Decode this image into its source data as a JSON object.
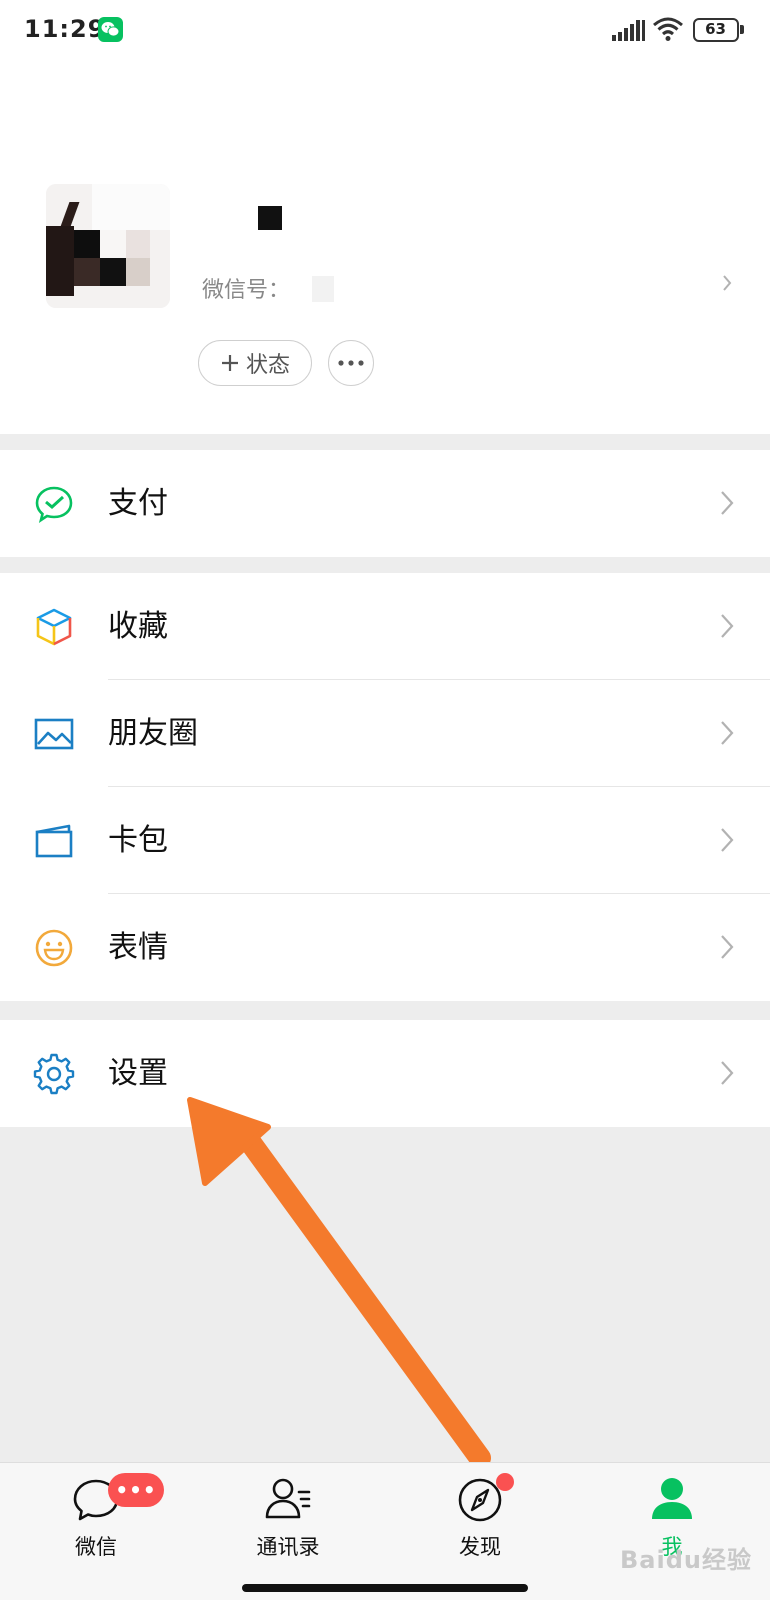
{
  "status_bar": {
    "time": "11:29",
    "battery": "63",
    "app_icon": "wechat-icon"
  },
  "profile": {
    "wechat_id_label": "微信号：",
    "status_button_label": "状态",
    "more_icon": "more-dots-icon"
  },
  "menu": {
    "pay": {
      "label": "支付",
      "icon": "pay-check-icon",
      "color": "#07c160"
    },
    "favorites": {
      "label": "收藏",
      "icon": "cube-icon"
    },
    "moments": {
      "label": "朋友圈",
      "icon": "picture-icon",
      "color": "#1b7fc4"
    },
    "cards": {
      "label": "卡包",
      "icon": "card-icon",
      "color": "#1b7fc4"
    },
    "stickers": {
      "label": "表情",
      "icon": "smile-icon",
      "color": "#f2a93b"
    },
    "settings": {
      "label": "设置",
      "icon": "gear-icon",
      "color": "#1b7fc4"
    }
  },
  "tab_bar": {
    "tabs": [
      {
        "label": "微信",
        "icon": "chat-bubble-icon",
        "badge": "•••"
      },
      {
        "label": "通讯录",
        "icon": "contacts-icon"
      },
      {
        "label": "发现",
        "icon": "compass-icon",
        "badge_dot": true
      },
      {
        "label": "我",
        "icon": "person-icon",
        "active": true,
        "color": "#07c160"
      }
    ]
  },
  "watermark": {
    "text": "Baidu经验"
  }
}
